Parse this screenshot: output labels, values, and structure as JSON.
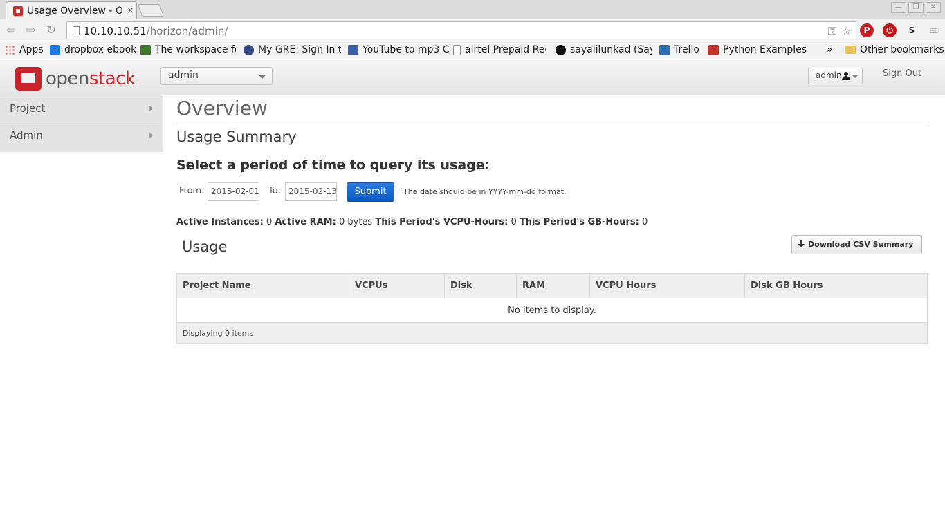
{
  "browser": {
    "tab_title": "Usage Overview - Op",
    "tab_close": "×",
    "url_host": "10.10.10.51",
    "url_path": "/horizon/admin/",
    "bookmarks": [
      {
        "label": "Apps",
        "color": "#e04444"
      },
      {
        "label": "dropbox ebook",
        "color": "#1f7ae0"
      },
      {
        "label": "The workspace fo",
        "color": "#3e7a2a"
      },
      {
        "label": "My GRE: Sign In t",
        "color": "#3a4b8a"
      },
      {
        "label": "YouTube to mp3 C",
        "color": "#3a5fb0"
      },
      {
        "label": "airtel Prepaid Rec",
        "color": "#ffffff"
      },
      {
        "label": "sayalilunkad (Say",
        "color": "#111111"
      },
      {
        "label": "Trello",
        "color": "#2a6fb6"
      },
      {
        "label": "Python Examples",
        "color": "#c2332c"
      }
    ],
    "bookmarks_overflow": "»",
    "other_bookmarks": "Other bookmarks"
  },
  "header": {
    "logo_open": "open",
    "logo_stack": "stack",
    "project_selector": "admin",
    "user_menu": "admin",
    "sign_out": "Sign Out"
  },
  "sidebar": {
    "items": [
      {
        "label": "Project"
      },
      {
        "label": "Admin"
      }
    ]
  },
  "main": {
    "page_title": "Overview",
    "usage_summary_title": "Usage Summary",
    "period_title": "Select a period of time to query its usage:",
    "from_label": "From:",
    "from_value": "2015-02-01",
    "to_label": "To:",
    "to_value": "2015-02-13",
    "submit_label": "Submit",
    "date_help": "The date should be in YYYY-mm-dd format.",
    "stats": {
      "active_instances_label": "Active Instances:",
      "active_instances_value": "0",
      "active_ram_label": "Active RAM:",
      "active_ram_value": "0 bytes",
      "vcpu_hours_label": "This Period's VCPU-Hours:",
      "vcpu_hours_value": "0",
      "gb_hours_label": "This Period's GB-Hours:",
      "gb_hours_value": "0"
    },
    "usage_title": "Usage",
    "csv_button": "Download CSV Summary",
    "table": {
      "columns": [
        "Project Name",
        "VCPUs",
        "Disk",
        "RAM",
        "VCPU Hours",
        "Disk GB Hours"
      ],
      "empty_message": "No items to display.",
      "footer": "Displaying 0 items"
    }
  }
}
